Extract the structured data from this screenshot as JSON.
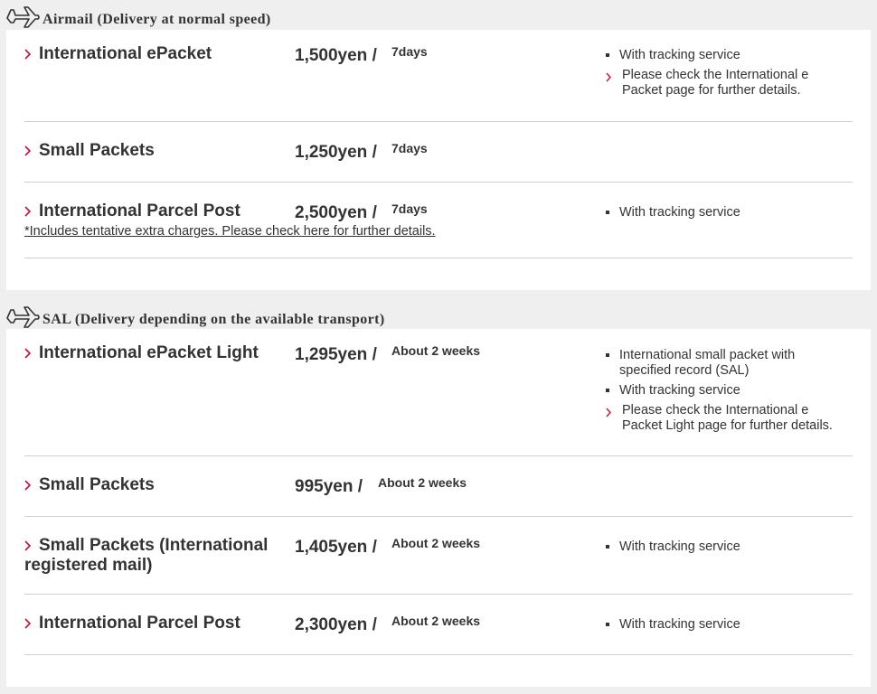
{
  "colors": {
    "accent": "#c8102e",
    "text": "#333333",
    "divider": "#cfcfcf"
  },
  "sections": [
    {
      "title": "Airmail (Delivery at normal speed)",
      "icon": "airplane-icon",
      "rows": [
        {
          "service": "International ePacket",
          "price": "1,500yen /",
          "days": "7days",
          "notes": [
            {
              "type": "bullet",
              "text": "With tracking service"
            },
            {
              "type": "link",
              "line1": "Please check the International e",
              "line2": "Packet page for further details."
            }
          ]
        },
        {
          "service": "Small Packets",
          "price": "1,250yen /",
          "days": "7days",
          "notes": []
        },
        {
          "service": "International Parcel Post",
          "price": "2,500yen /",
          "days": "7days",
          "extra": "*Includes tentative extra charges. Please check here for further details.",
          "notes": [
            {
              "type": "bullet",
              "text": "With tracking service"
            }
          ]
        }
      ]
    },
    {
      "title": "SAL (Delivery depending on the available transport)",
      "icon": "airplane-icon",
      "rows": [
        {
          "service": "International ePacket Light",
          "price": "1,295yen /",
          "days": "About 2 weeks",
          "notes": [
            {
              "type": "bullet",
              "line1": "International small packet with",
              "line2": "specified record (SAL)"
            },
            {
              "type": "bullet",
              "text": "With tracking service"
            },
            {
              "type": "link",
              "line1": "Please check the International e",
              "line2": "Packet Light page for further details."
            }
          ]
        },
        {
          "service": "Small Packets",
          "price": "995yen /",
          "days": "About 2 weeks",
          "notes": []
        },
        {
          "service_line1": "Small Packets (International",
          "service_line2": "registered mail)",
          "price": "1,405yen /",
          "days": "About 2 weeks",
          "notes": [
            {
              "type": "bullet",
              "text": "With tracking service"
            }
          ]
        },
        {
          "service": "International Parcel Post",
          "price": "2,300yen /",
          "days": "About 2 weeks",
          "notes": [
            {
              "type": "bullet",
              "text": "With tracking service"
            }
          ]
        }
      ]
    }
  ]
}
